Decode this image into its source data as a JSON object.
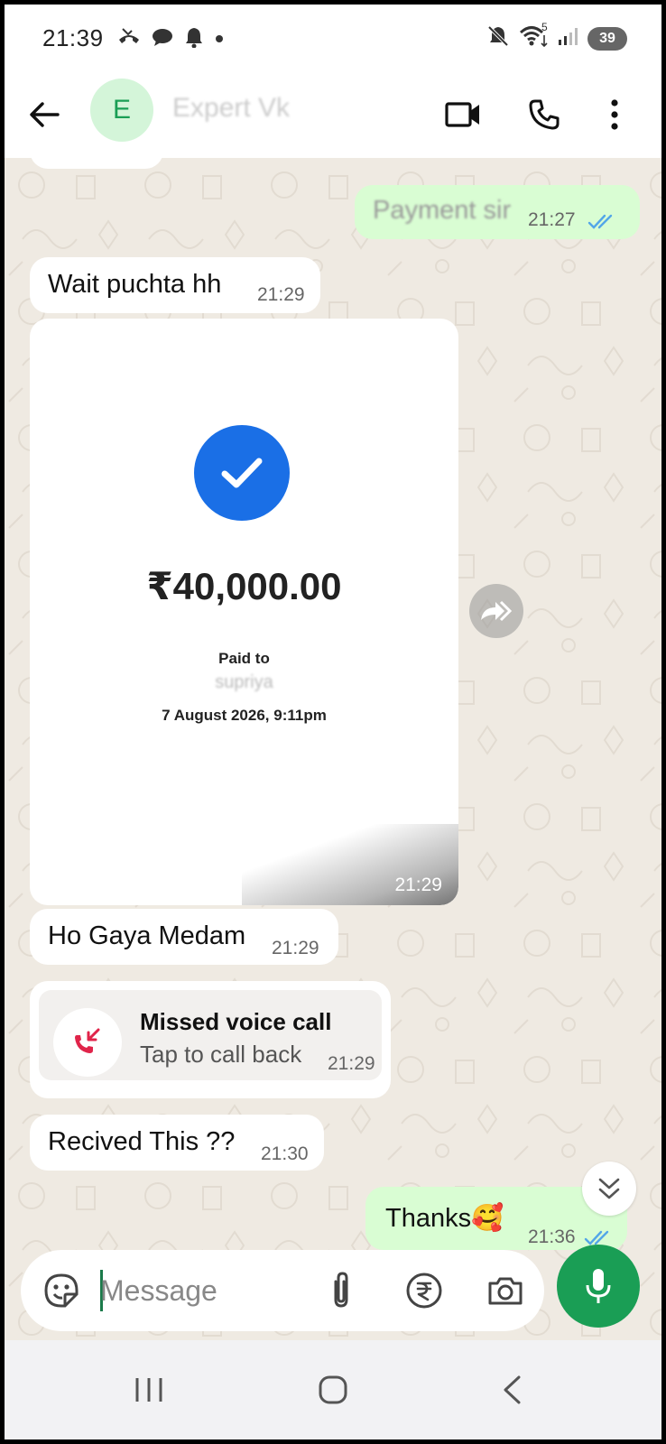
{
  "status_bar": {
    "time": "21:39",
    "battery": "39",
    "signal_superscript": "5"
  },
  "header": {
    "avatar_letter": "E",
    "contact_name": "Expert Vk"
  },
  "messages": [
    {
      "text": "Payment sir",
      "time": "21:27",
      "direction": "out",
      "status": "read"
    },
    {
      "text": "Wait puchta hh",
      "time": "21:29",
      "direction": "in"
    },
    {
      "text": "Ho Gaya Medam",
      "time": "21:29",
      "direction": "in"
    },
    {
      "text": "Recived This ??",
      "time": "21:30",
      "direction": "in"
    },
    {
      "text": "Thanks🥰",
      "time": "21:36",
      "direction": "out",
      "status": "read"
    }
  ],
  "payment_image": {
    "amount": "₹40,000.00",
    "paid_to_label": "Paid to",
    "payee": "supriya",
    "date": "7 August 2026, 9:11pm",
    "time": "21:29"
  },
  "missed_call": {
    "title": "Missed voice call",
    "subtitle": "Tap to call back",
    "time": "21:29"
  },
  "composer": {
    "placeholder": "Message"
  },
  "colors": {
    "accent_green": "#1a9e55",
    "outgoing_bubble": "#d9fdd3",
    "chat_background": "#efeae2",
    "read_ticks": "#53a6e8",
    "missed_call_red": "#e0244a",
    "payment_check": "#1a6fe6"
  },
  "icons": [
    "back-arrow-icon",
    "video-call-icon",
    "voice-call-icon",
    "more-options-icon",
    "sticker-icon",
    "attach-icon",
    "rupee-payment-icon",
    "camera-icon",
    "mic-icon",
    "forward-icon",
    "scroll-down-icon",
    "missed-call-icon"
  ]
}
